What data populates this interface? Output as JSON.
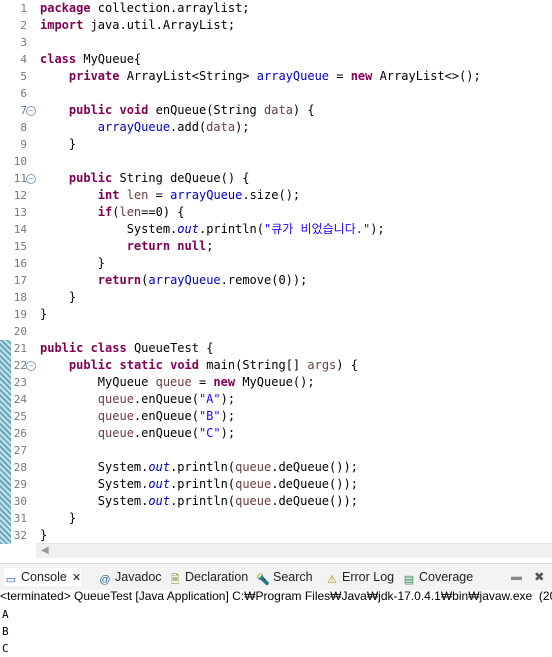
{
  "editor": {
    "line_numbers": [
      "1",
      "2",
      "3",
      "4",
      "5",
      "6",
      "7",
      "8",
      "9",
      "10",
      "11",
      "12",
      "13",
      "14",
      "15",
      "16",
      "17",
      "18",
      "19",
      "20",
      "21",
      "22",
      "23",
      "24",
      "25",
      "26",
      "27",
      "28",
      "29",
      "30",
      "31",
      "32"
    ],
    "lines": [
      [
        {
          "t": "package",
          "c": "kw"
        },
        {
          "t": " collection.arraylist;"
        }
      ],
      [
        {
          "t": "import",
          "c": "kw"
        },
        {
          "t": " java.util.ArrayList;"
        }
      ],
      [],
      [
        {
          "t": "class",
          "c": "kw"
        },
        {
          "t": " MyQueue{"
        }
      ],
      [
        {
          "t": "    "
        },
        {
          "t": "private",
          "c": "kw"
        },
        {
          "t": " ArrayList<String> "
        },
        {
          "t": "arrayQueue",
          "c": "fld"
        },
        {
          "t": " = "
        },
        {
          "t": "new",
          "c": "kw"
        },
        {
          "t": " ArrayList<>();"
        }
      ],
      [],
      [
        {
          "t": "    "
        },
        {
          "t": "public",
          "c": "kw"
        },
        {
          "t": " "
        },
        {
          "t": "void",
          "c": "kw"
        },
        {
          "t": " enQueue(String "
        },
        {
          "t": "data",
          "c": "var"
        },
        {
          "t": ") {"
        }
      ],
      [
        {
          "t": "        "
        },
        {
          "t": "arrayQueue",
          "c": "fld"
        },
        {
          "t": ".add("
        },
        {
          "t": "data",
          "c": "var"
        },
        {
          "t": ");"
        }
      ],
      [
        {
          "t": "    }"
        }
      ],
      [],
      [
        {
          "t": "    "
        },
        {
          "t": "public",
          "c": "kw"
        },
        {
          "t": " String deQueue() {"
        }
      ],
      [
        {
          "t": "        "
        },
        {
          "t": "int",
          "c": "kw"
        },
        {
          "t": " "
        },
        {
          "t": "len",
          "c": "var"
        },
        {
          "t": " = "
        },
        {
          "t": "arrayQueue",
          "c": "fld"
        },
        {
          "t": ".size();"
        }
      ],
      [
        {
          "t": "        "
        },
        {
          "t": "if",
          "c": "kw"
        },
        {
          "t": "("
        },
        {
          "t": "len",
          "c": "var"
        },
        {
          "t": "==0) {"
        }
      ],
      [
        {
          "t": "            System."
        },
        {
          "t": "out",
          "c": "sfld"
        },
        {
          "t": ".println("
        },
        {
          "t": "\"큐가 비었습니다.\"",
          "c": "str"
        },
        {
          "t": ");"
        }
      ],
      [
        {
          "t": "            "
        },
        {
          "t": "return",
          "c": "kw"
        },
        {
          "t": " "
        },
        {
          "t": "null",
          "c": "kw"
        },
        {
          "t": ";"
        }
      ],
      [
        {
          "t": "        }"
        }
      ],
      [
        {
          "t": "        "
        },
        {
          "t": "return",
          "c": "kw"
        },
        {
          "t": "("
        },
        {
          "t": "arrayQueue",
          "c": "fld"
        },
        {
          "t": ".remove(0));"
        }
      ],
      [
        {
          "t": "    }"
        }
      ],
      [
        {
          "t": "}"
        }
      ],
      [],
      [
        {
          "t": "public",
          "c": "kw"
        },
        {
          "t": " "
        },
        {
          "t": "class",
          "c": "kw"
        },
        {
          "t": " QueueTest {"
        }
      ],
      [
        {
          "t": "    "
        },
        {
          "t": "public",
          "c": "kw"
        },
        {
          "t": " "
        },
        {
          "t": "static",
          "c": "kw"
        },
        {
          "t": " "
        },
        {
          "t": "void",
          "c": "kw"
        },
        {
          "t": " main(String[] "
        },
        {
          "t": "args",
          "c": "var"
        },
        {
          "t": ") {"
        }
      ],
      [
        {
          "t": "        MyQueue "
        },
        {
          "t": "queue",
          "c": "var"
        },
        {
          "t": " = "
        },
        {
          "t": "new",
          "c": "kw"
        },
        {
          "t": " MyQueue();"
        }
      ],
      [
        {
          "t": "        "
        },
        {
          "t": "queue",
          "c": "var"
        },
        {
          "t": ".enQueue("
        },
        {
          "t": "\"A\"",
          "c": "str"
        },
        {
          "t": ");"
        }
      ],
      [
        {
          "t": "        "
        },
        {
          "t": "queue",
          "c": "var"
        },
        {
          "t": ".enQueue("
        },
        {
          "t": "\"B\"",
          "c": "str"
        },
        {
          "t": ");"
        }
      ],
      [
        {
          "t": "        "
        },
        {
          "t": "queue",
          "c": "var"
        },
        {
          "t": ".enQueue("
        },
        {
          "t": "\"C\"",
          "c": "str"
        },
        {
          "t": ");"
        }
      ],
      [],
      [
        {
          "t": "        System."
        },
        {
          "t": "out",
          "c": "sfld"
        },
        {
          "t": ".println("
        },
        {
          "t": "queue",
          "c": "var"
        },
        {
          "t": ".deQueue());"
        }
      ],
      [
        {
          "t": "        System."
        },
        {
          "t": "out",
          "c": "sfld"
        },
        {
          "t": ".println("
        },
        {
          "t": "queue",
          "c": "var"
        },
        {
          "t": ".deQueue());"
        }
      ],
      [
        {
          "t": "        System."
        },
        {
          "t": "out",
          "c": "sfld"
        },
        {
          "t": ".println("
        },
        {
          "t": "queue",
          "c": "var"
        },
        {
          "t": ".deQueue());"
        }
      ],
      [
        {
          "t": "    }"
        }
      ],
      [
        {
          "t": "}"
        }
      ]
    ],
    "fold_markers": {
      "line7": "−",
      "line11": "−",
      "line22": "−"
    },
    "marked_lines": [
      "21",
      "22",
      "23",
      "24",
      "25",
      "26",
      "27",
      "28",
      "29",
      "30",
      "31",
      "32"
    ]
  },
  "scrollbar": {
    "left_arrow_icon": "chevron-left-icon",
    "left_arrow": "◀"
  },
  "console_tabs": [
    {
      "label": "Console",
      "icon": "console-icon",
      "glyph": "▭",
      "icon_color": "#2a5aa8",
      "close": "✕"
    },
    {
      "label": "Javadoc",
      "icon": "at-sign-icon",
      "glyph": "@",
      "icon_color": "#3a6ea5"
    },
    {
      "label": "Declaration",
      "icon": "declaration-icon",
      "glyph": "🗎",
      "icon_color": "#6b8e23"
    },
    {
      "label": "Search",
      "icon": "search-icon",
      "glyph": "🔦",
      "icon_color": "#d18a00"
    },
    {
      "label": "Error Log",
      "icon": "error-log-icon",
      "glyph": "⚠",
      "icon_color": "#b8860b"
    },
    {
      "label": "Coverage",
      "icon": "coverage-icon",
      "glyph": "▤",
      "icon_color": "#2e8b57"
    }
  ],
  "console_actions": {
    "minimize_icon": "minimize-icon",
    "minimize": "▬",
    "close_icon": "close-all-icon",
    "close": "✖"
  },
  "console": {
    "status": "<terminated> QueueTest [Java Application] C:₩Program Files₩Java₩jdk-17.0.4.1₩bin₩javaw.exe  (202",
    "output": [
      "A",
      "B",
      "C"
    ]
  }
}
